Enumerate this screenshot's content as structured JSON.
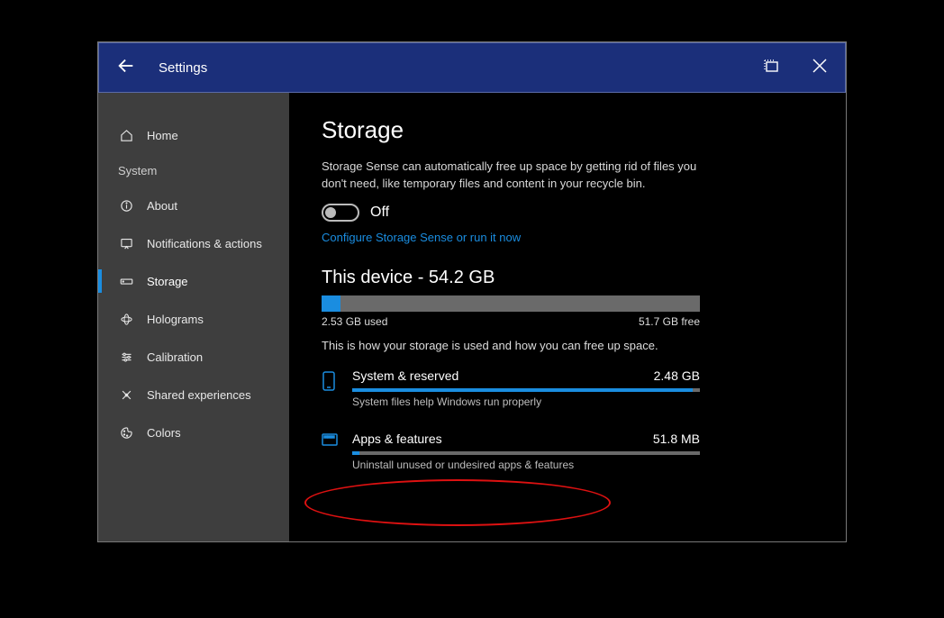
{
  "header": {
    "title": "Settings"
  },
  "sidebar": {
    "home": "Home",
    "group": "System",
    "items": [
      {
        "label": "About"
      },
      {
        "label": "Notifications & actions"
      },
      {
        "label": "Storage"
      },
      {
        "label": "Holograms"
      },
      {
        "label": "Calibration"
      },
      {
        "label": "Shared experiences"
      },
      {
        "label": "Colors"
      }
    ]
  },
  "main": {
    "title": "Storage",
    "desc": "Storage Sense can automatically free up space by getting rid of files you don't need, like temporary files and content in your recycle bin.",
    "toggle_label": "Off",
    "configure_link": "Configure Storage Sense or run it now",
    "device_heading": "This device - 54.2 GB",
    "used_label": "2.53 GB used",
    "free_label": "51.7 GB free",
    "used_pct": 5,
    "breakdown_intro": "This is how your storage is used and how you can free up space.",
    "categories": [
      {
        "title": "System & reserved",
        "size": "2.48 GB",
        "sub": "System files help Windows run properly",
        "pct": 98
      },
      {
        "title": "Apps & features",
        "size": "51.8 MB",
        "sub": "Uninstall unused or undesired apps & features",
        "pct": 2
      }
    ]
  }
}
